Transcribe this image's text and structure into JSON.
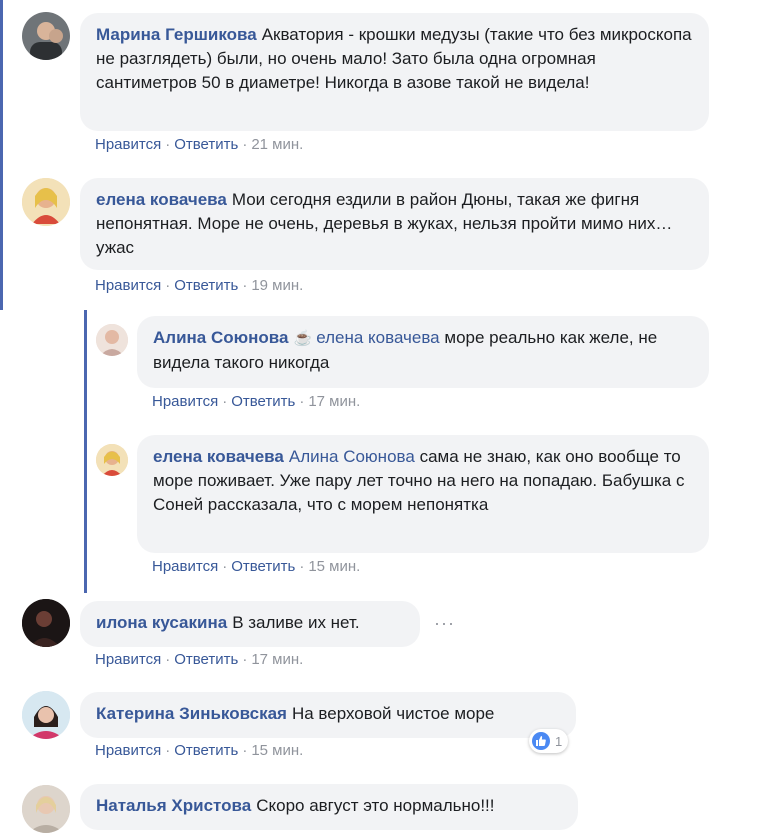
{
  "comments": [
    {
      "author": "Марина Гершикова",
      "text": "Акватория - крошки медузы (такие что без микроскопа не разглядеть) были, но очень мало! Зато была одна огромная сантиметров 50 в диаметре! Никогда в азове такой не видела!",
      "like": "Нравится",
      "reply": "Ответить",
      "time": "21 мин."
    },
    {
      "author": "елена ковачева",
      "text": "Мои сегодня ездили в район Дюны, такая же фигня непонятная. Море не очень, деревья в жуках, нельзя пройти мимо них… ужас",
      "like": "Нравится",
      "reply": "Ответить",
      "time": "19 мин."
    },
    {
      "author": "Алина Союнова",
      "mention": "елена ковачева",
      "text": "море реально как желе, не видела такого никогда",
      "like": "Нравится",
      "reply": "Ответить",
      "time": "17 мин."
    },
    {
      "author": "елена ковачева",
      "mention": "Алина Союнова",
      "text": "сама не знаю, как оно вообще то море поживает. Уже пару лет точно на него на попадаю. Бабушка с Соней рассказала, что с морем непонятка",
      "like": "Нравится",
      "reply": "Ответить",
      "time": "15 мин."
    },
    {
      "author": "илона кусакина",
      "text": "В заливе их нет.",
      "like": "Нравится",
      "reply": "Ответить",
      "time": "17 мин."
    },
    {
      "author": "Катерина Зиньковская",
      "text": "На верховой чистое море",
      "like": "Нравится",
      "reply": "Ответить",
      "time": "15 мин.",
      "reaction_count": "1"
    },
    {
      "author": "Наталья Христова",
      "text": "Скоро август это нормально!!!"
    }
  ],
  "separator": "·",
  "icons": {
    "coffee": "coffee-icon",
    "like": "like-reaction-icon",
    "more": "more-options-icon"
  },
  "colors": {
    "author": "#385898",
    "bubble": "#f2f3f5",
    "thread": "#4b67b0",
    "meta": "#90949c",
    "like": "#4a89f3"
  }
}
